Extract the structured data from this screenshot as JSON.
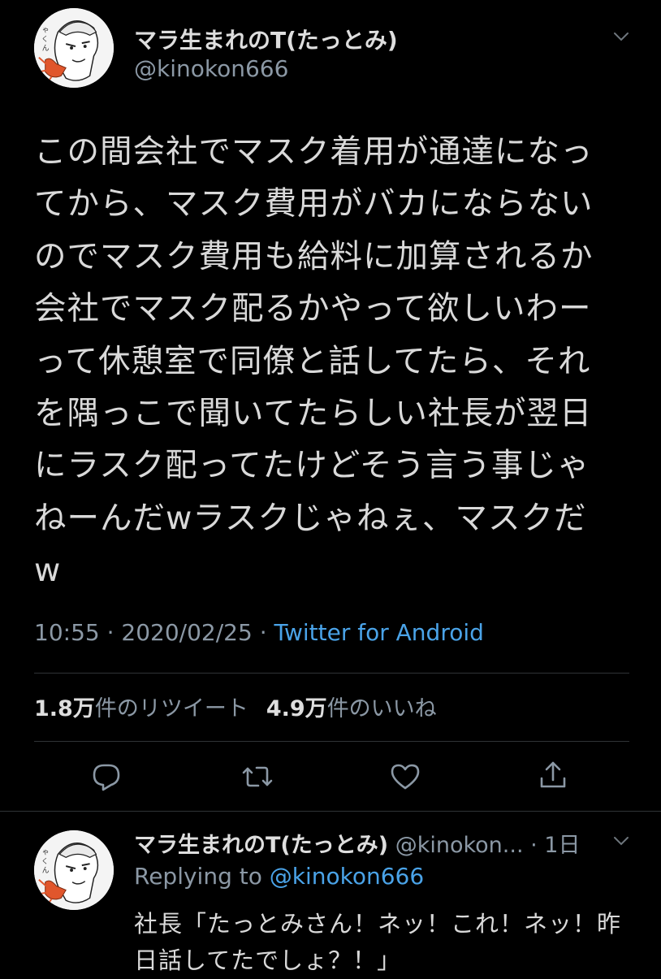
{
  "colors": {
    "background": "#000000",
    "text": "#d9d9d9",
    "muted": "#8b98a5",
    "link": "#4aa3e8",
    "divider": "#2f3336"
  },
  "tweet": {
    "display_name": "マラ生まれのT(たっとみ)",
    "handle": "@kinokon666",
    "body": "この間会社でマスク着用が通達になっ\nてから、マスク費用がバカにならない\nのでマスク費用も給料に加算されるか\n会社でマスク配るかやって欲しいわー\nって休憩室で同僚と話してたら、それ\nを隅っこで聞いてたらしい社長が翌日\nにラスク配ってたけどそう言う事じゃ\nねーんだwラスクじゃねぇ、マスクだ\nw",
    "time": "10:55",
    "date": "2020/02/25",
    "separator": " · ",
    "source": "Twitter for Android",
    "retweets_count": "1.8万",
    "retweets_label": "件のリツイート",
    "likes_count": "4.9万",
    "likes_label": "件のいいね",
    "icons": {
      "reply": "reply-icon",
      "retweet": "retweet-icon",
      "like": "heart-icon",
      "share": "share-icon",
      "more": "chevron-down-icon"
    }
  },
  "reply": {
    "display_name": "マラ生まれのT(たっとみ)",
    "handle": "@kinokon...",
    "time_ago": "1日",
    "time_separator": " · ",
    "replying_prefix": "Replying to ",
    "replying_to": "@kinokon666",
    "body": "社長「たっとみさん！ネッ！これ！ネッ！昨\n日話してたでしょ？！」"
  }
}
